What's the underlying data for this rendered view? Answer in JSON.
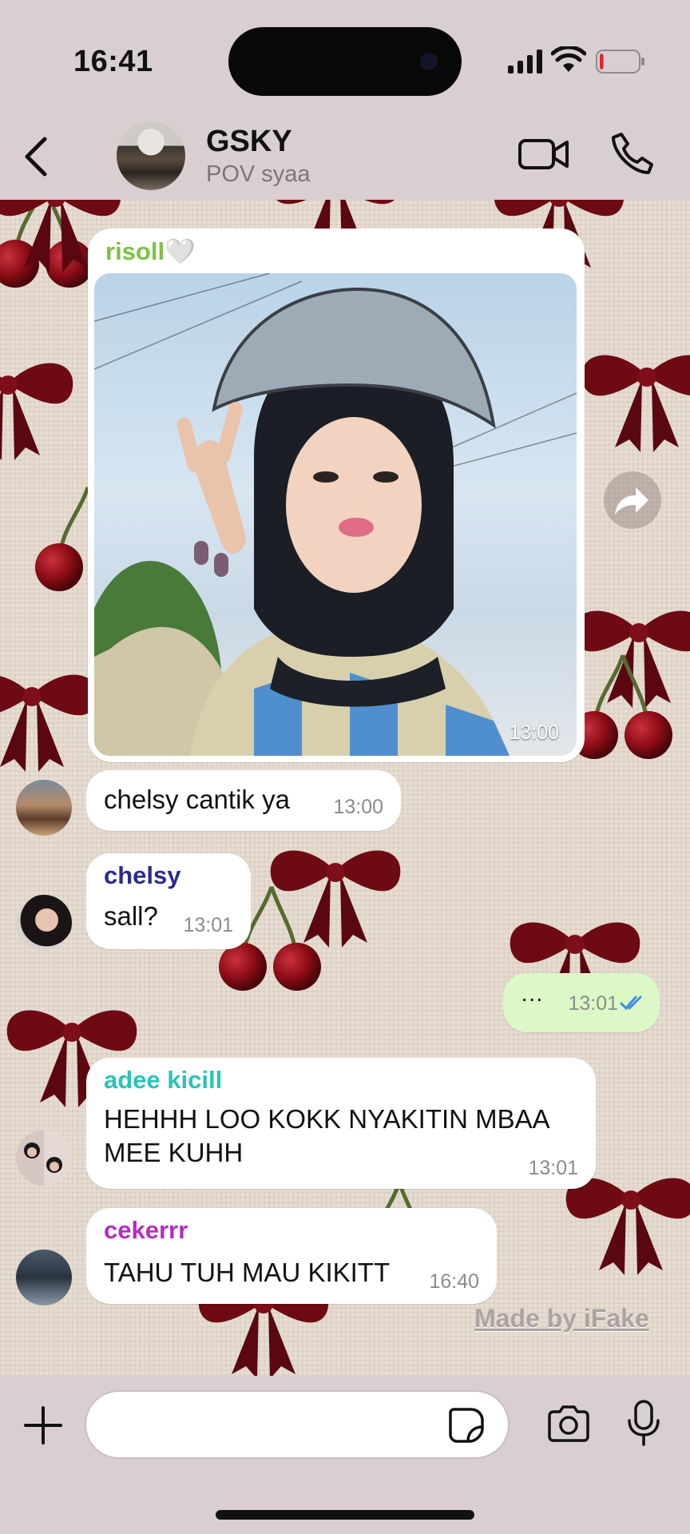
{
  "status_bar": {
    "time": "16:41",
    "battery_level": 0.1
  },
  "header": {
    "title": "GSKY",
    "subtitle": "POV syaa"
  },
  "messages": [
    {
      "sender": "risoll🤍",
      "sender_color": "#7cc243",
      "type": "image",
      "time": "13:00"
    },
    {
      "type": "text",
      "text": "chelsy cantik ya",
      "time": "13:00"
    },
    {
      "sender": "chelsy",
      "sender_color": "#2b2b8e",
      "type": "text",
      "text": "sall?",
      "time": "13:01"
    },
    {
      "type": "text",
      "direction": "outgoing",
      "text": "···",
      "time": "13:01",
      "read_receipt": "double-check-icon"
    },
    {
      "sender": "adee kicill",
      "sender_color": "#29c4b6",
      "type": "text",
      "text_lines": [
        "HEHHH LOO KOKK NYAKITIN MBAA",
        "MEE KUHH"
      ],
      "time": "13:01"
    },
    {
      "sender": "cekerrr",
      "sender_color": "#b32dbf",
      "type": "text",
      "text": "TAHU TUH MAU KIKITT",
      "time": "16:40"
    }
  ],
  "watermark": "Made by iFake",
  "input": {
    "placeholder": ""
  },
  "colors": {
    "bar_bg": "#d9cfd1",
    "bubble_in": "#ffffff",
    "bubble_out": "#dcf8c6",
    "read_tick": "#3b8ee6"
  }
}
